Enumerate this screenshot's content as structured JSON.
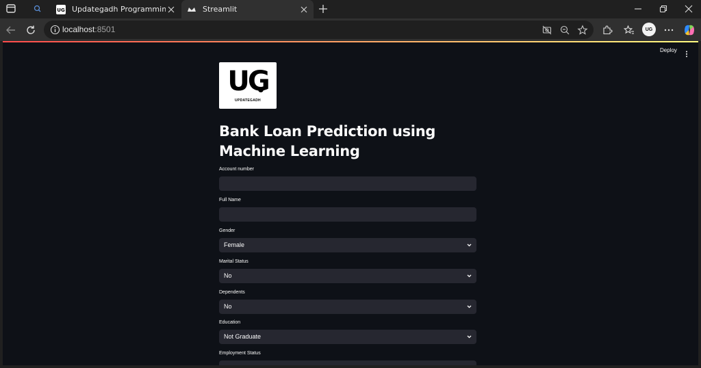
{
  "tabs": [
    {
      "title": "Updategadh Programming - Upd",
      "favicon": "ug-icon",
      "active": false
    },
    {
      "title": "Streamlit",
      "favicon": "streamlit-crown-icon",
      "active": true
    }
  ],
  "address_bar": {
    "host": "localhost",
    "port": ":8501"
  },
  "profile_avatar": "UG",
  "app": {
    "deploy_label": "Deploy",
    "logo": {
      "mark": "UG",
      "caption": "UPDATEGADH"
    },
    "title": "Bank Loan Prediction using Machine Learning",
    "fields": [
      {
        "label": "Account number",
        "type": "text",
        "value": ""
      },
      {
        "label": "Full Name",
        "type": "text",
        "value": ""
      },
      {
        "label": "Gender",
        "type": "select",
        "value": "Female"
      },
      {
        "label": "Marital Status",
        "type": "select",
        "value": "No"
      },
      {
        "label": "Dependents",
        "type": "select",
        "value": "No"
      },
      {
        "label": "Education",
        "type": "select",
        "value": "Not Graduate"
      },
      {
        "label": "Employment Status",
        "type": "select",
        "value": ""
      }
    ]
  },
  "colors": {
    "app_background": "#0e1117",
    "widget_background": "#262730",
    "text": "#fafafa",
    "browser_chrome": "#202020",
    "toolbar": "#303030"
  }
}
